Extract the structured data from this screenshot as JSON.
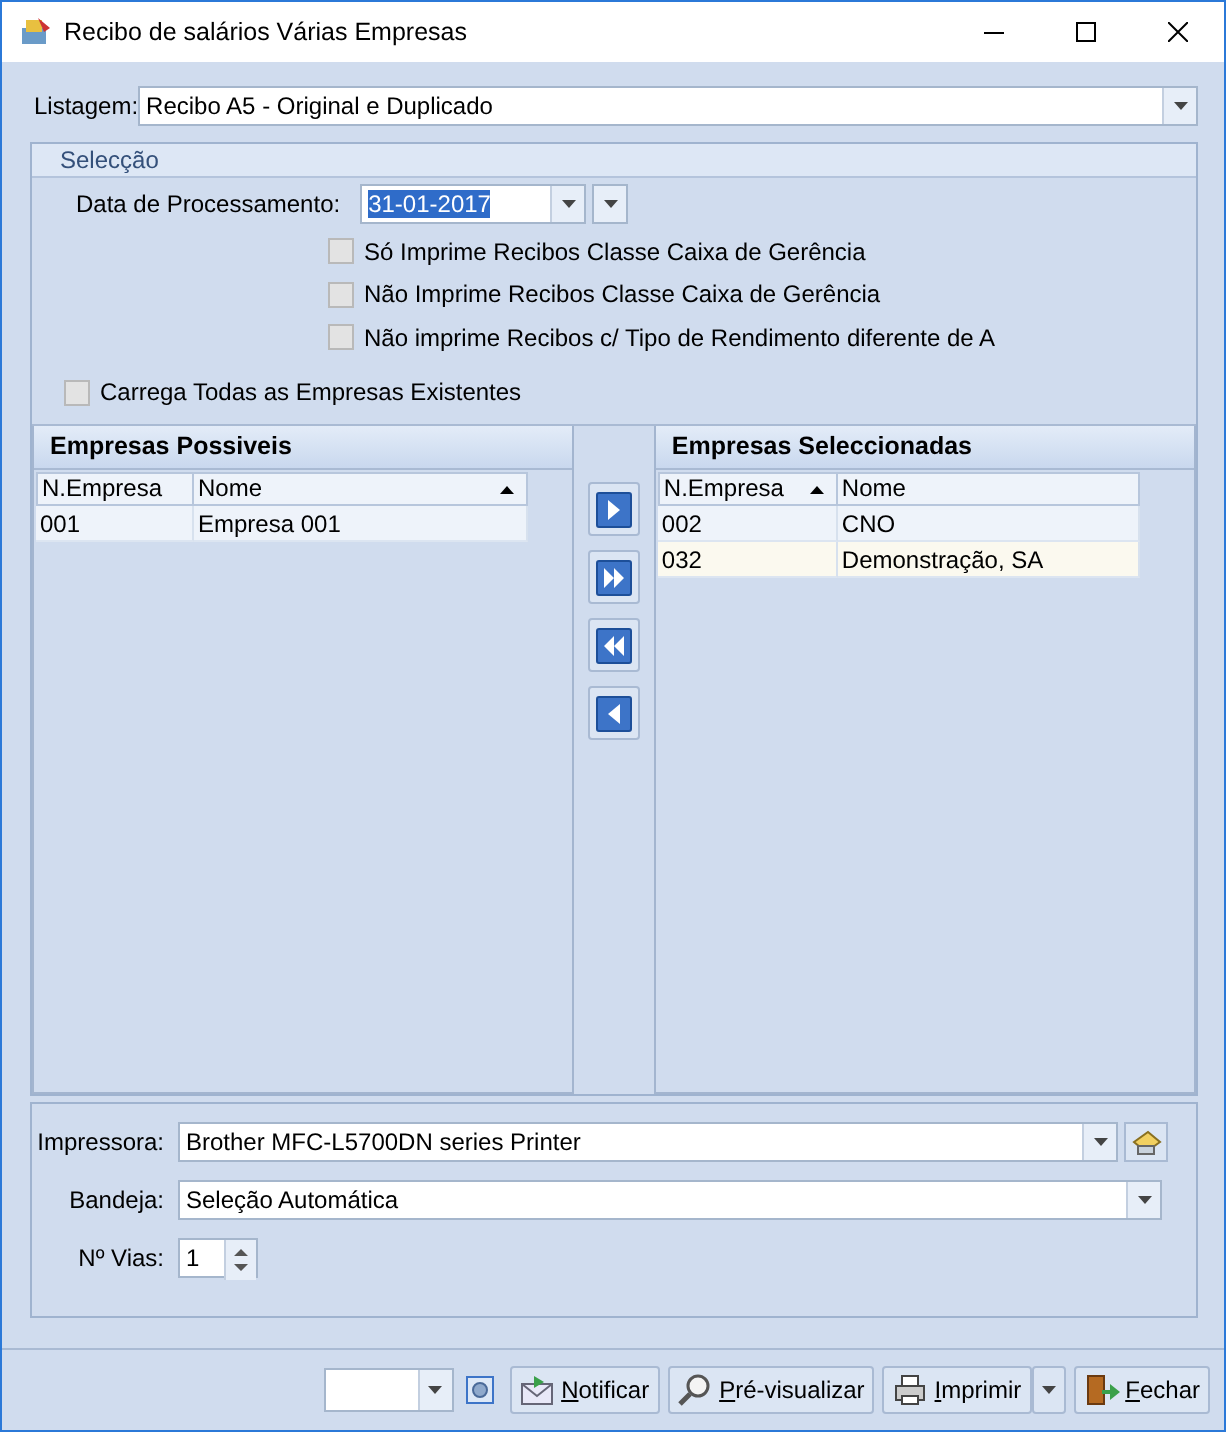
{
  "window": {
    "title": "Recibo de salários Várias Empresas"
  },
  "listagem": {
    "label": "Listagem:",
    "value": "Recibo A5 - Original e Duplicado"
  },
  "seleccao": {
    "title": "Selecção",
    "date": {
      "label": "Data de Processamento:",
      "value": "31-01-2017",
      "highlighted": true
    },
    "options": [
      {
        "label": "Só Imprime Recibos Classe Caixa de Gerência",
        "checked": false
      },
      {
        "label": "Não Imprime Recibos Classe Caixa de Gerência",
        "checked": false
      },
      {
        "label": "Não imprime Recibos c/ Tipo de Rendimento diferente de A",
        "checked": false
      }
    ],
    "load_all": {
      "label": "Carrega Todas as Empresas Existentes",
      "checked": false
    }
  },
  "lists": [
    {
      "title": "Empresas Possiveis",
      "columns": [
        {
          "label": "N.Empresa",
          "sorted": false
        },
        {
          "label": "Nome",
          "sorted": true
        }
      ],
      "rows": [
        {
          "cells": [
            "001",
            "Empresa 001"
          ]
        }
      ]
    },
    {
      "title": "Empresas Seleccionadas",
      "columns": [
        {
          "label": "N.Empresa",
          "sorted": true
        },
        {
          "label": "Nome",
          "sorted": false
        }
      ],
      "rows": [
        {
          "cells": [
            "002",
            "CNO"
          ]
        },
        {
          "cells": [
            "032",
            "Demonstração, SA"
          ]
        }
      ]
    }
  ],
  "transfer_buttons": [
    {
      "kind": "add"
    },
    {
      "kind": "add_all"
    },
    {
      "kind": "remove_all"
    },
    {
      "kind": "remove"
    }
  ],
  "printer": {
    "printer": {
      "label": "Impressora:",
      "value": "Brother MFC-L5700DN series Printer"
    },
    "tray": {
      "label": "Bandeja:",
      "value": "Seleção Automática"
    },
    "copies": {
      "label": "Nº Vias:",
      "value": "1"
    }
  },
  "footer": {
    "buttons": [
      {
        "kind": "notify",
        "label": "Notificar"
      },
      {
        "kind": "preview",
        "label": "Pré-visualizar"
      },
      {
        "kind": "print",
        "label": "Imprimir"
      },
      {
        "kind": "close",
        "label": "Fechar"
      }
    ]
  }
}
